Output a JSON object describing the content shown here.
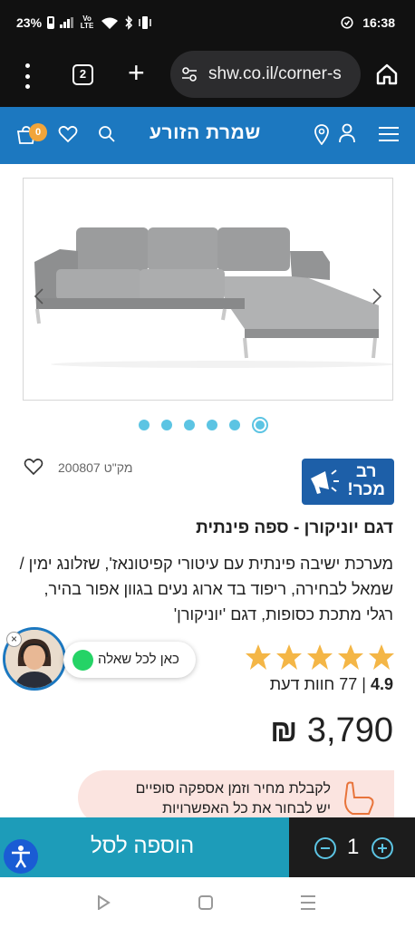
{
  "status_bar": {
    "battery": "23%",
    "volte": "Vo LTE",
    "time": "16:38"
  },
  "browser": {
    "tab_count": "2",
    "url": "shw.co.il/corner-s"
  },
  "site_header": {
    "brand": "שמרת הזורע",
    "cart_count": "0",
    "colors": {
      "header_bg": "#1c78c0",
      "badge": "#f1a53b"
    }
  },
  "gallery": {
    "slides_count": 6,
    "active_slide": 6
  },
  "product": {
    "sku": "מק\"ט 200807",
    "badge": {
      "line1": "רב",
      "line2": "מכר!"
    },
    "title": "דגם יוניקורן - ספה פינתית",
    "description": "מערכת ישיבה פינתית עם עיטורי קפיטונאז', שזלונג ימין / שמאל לבחירה, ריפוד בד ארוג נעים בגוון אפור בהיר, רגלי מתכת כסופות, דגם 'יוניקורן'",
    "rating_value": "4.9",
    "rating_separator": "|",
    "reviews_text": "77 חוות דעת",
    "stars_filled": 5,
    "price": "3,790",
    "currency": "₪"
  },
  "chat": {
    "label": "כאן לכל שאלה",
    "close": "×"
  },
  "promo": {
    "line1": "לקבלת מחיר וזמן אספקה סופיים",
    "line2": "יש לבחור את כל האפשרויות"
  },
  "cart_bar": {
    "add_label": "הוספה לסל",
    "quantity": "1",
    "colors": {
      "add_bg": "#1d9cb9",
      "qty_bg": "#1c1c1c"
    }
  }
}
